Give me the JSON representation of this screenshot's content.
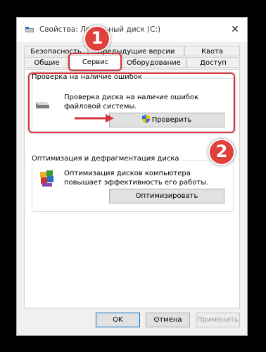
{
  "window": {
    "title": "Свойства: Локальный диск (C:)",
    "close_glyph": "✕"
  },
  "tabs_row1": [
    "Безопасность",
    "Предыдущие версии",
    "Квота"
  ],
  "tabs_row2": [
    "Общие",
    "Сервис",
    "Оборудование",
    "Доступ"
  ],
  "active_tab": "Сервис",
  "check_section": {
    "title": "Проверка на наличие ошибок",
    "description": "Проверка диска на наличие ошибок файловой системы.",
    "button_label": "Проверить"
  },
  "optimize_section": {
    "title": "Оптимизация и дефрагментация диска",
    "description": "Оптимизация дисков компьютера повышает эффективность его работы.",
    "button_label": "Оптимизировать"
  },
  "footer": {
    "ok": "OK",
    "cancel": "Отмена",
    "apply": "Применить"
  },
  "annotations": {
    "badge1": "1",
    "badge2": "2"
  },
  "colors": {
    "highlight": "#d9343c",
    "window_bg": "#f0f0f0"
  }
}
